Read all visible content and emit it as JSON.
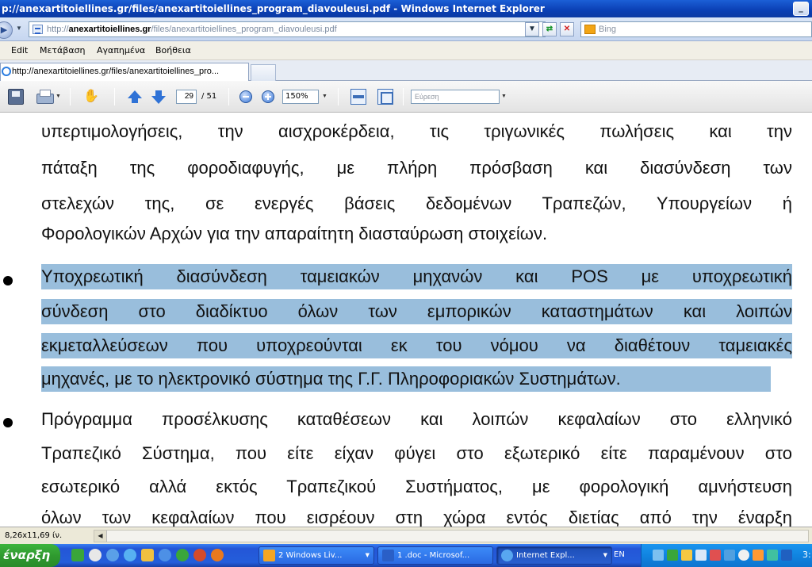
{
  "window": {
    "title": "p://anexartitoiellines.gr/files/anexartitoiellines_program_diavouleusi.pdf - Windows Internet Explorer",
    "minimize_glyph": "_"
  },
  "address_bar": {
    "url_prefix": "http://",
    "url_host": "anexartitoiellines.gr",
    "url_path": "/files/anexartitoiellines_program_diavouleusi.pdf",
    "search_placeholder": "Bing"
  },
  "menu": {
    "items": [
      "Edit",
      "Μετάβαση",
      "Αγαπημένα",
      "Βοήθεια"
    ]
  },
  "tabs": {
    "active_label": "http://anexartitoiellines.gr/files/anexartitoiellines_pro..."
  },
  "pdf_toolbar": {
    "current_page": "29",
    "total_pages": "/ 51",
    "zoom": "150%",
    "find_placeholder": "Εύρεση"
  },
  "document": {
    "lines": [
      "υπερτιμολογήσεις, την αισχροκέρδεια, τις τριγωνικές πωλήσεις και την",
      "πάταξη της φοροδιαφυγής, με πλήρη πρόσβαση και διασύνδεση των",
      "στελεχών της, σε ενεργές βάσεις δεδομένων Τραπεζών, Υπουργείων ή",
      "Φορολογικών Αρχών για την απαραίτητη διασταύρωση στοιχείων.",
      "Υποχρεωτική διασύνδεση ταμειακών μηχανών και POS με υποχρεωτική",
      "σύνδεση στο διαδίκτυο όλων των εμπορικών καταστημάτων και λοιπών",
      "εκμεταλλεύσεων που υποχρεούνται εκ του νόμου να διαθέτουν ταμειακές",
      "μηχανές, με το ηλεκτρονικό σύστημα της Γ.Γ. Πληροφοριακών Συστημάτων.",
      "Πρόγραμμα προσέλκυσης καταθέσεων και λοιπών κεφαλαίων στο ελληνικό",
      "Τραπεζικό Σύστημα, που είτε είχαν φύγει στο εξωτερικό είτε παραμένουν στο",
      "εσωτερικό αλλά εκτός Τραπεζικού Συστήματος, με φορολογική αμνήστευση",
      "όλων των κεφαλαίων που εισρέουν στη χώρα εντός διετίας από την έναρξη"
    ],
    "highlight_color": "#99bedc"
  },
  "status_bar": {
    "page_size": "8,26x11,69 ίν."
  },
  "taskbar": {
    "start_label": "έναρξη",
    "tasks": [
      {
        "label": "2 Windows Liv...",
        "icon_color": "#f5a623"
      },
      {
        "label": "1 .doc - Microsof...",
        "icon_color": "#2a5fc7"
      },
      {
        "label": "Internet Expl...",
        "icon_color": "#58a6f0"
      }
    ],
    "language": "EN",
    "clock": "3:"
  }
}
